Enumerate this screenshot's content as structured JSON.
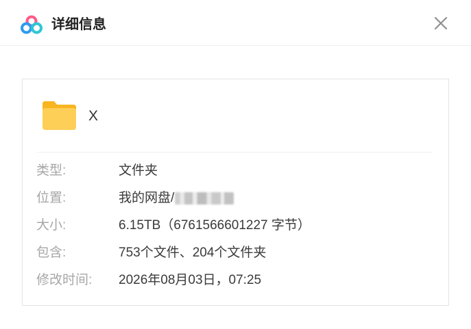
{
  "dialog": {
    "title": "详细信息",
    "logo_icon": "baidu-netdisk-logo-icon",
    "close_icon": "close-icon"
  },
  "file": {
    "icon": "folder-icon",
    "name": "X"
  },
  "details": [
    {
      "label": "类型:",
      "value": "文件夹"
    },
    {
      "label": "位置:",
      "value": "我的网盘/"
    },
    {
      "label": "大小:",
      "value": "6.15TB（6761566601227 字节）"
    },
    {
      "label": "包含:",
      "value": "753个文件、204个文件夹"
    },
    {
      "label": "修改时间:",
      "value": "2026年08月03日，07:25"
    }
  ],
  "colors": {
    "label": "#a6a6a6",
    "value": "#3a3a3a",
    "folder": "#fdc642",
    "logo_blue": "#2e9bf0",
    "logo_pink": "#ff5b86",
    "logo_teal": "#30c6d6"
  }
}
